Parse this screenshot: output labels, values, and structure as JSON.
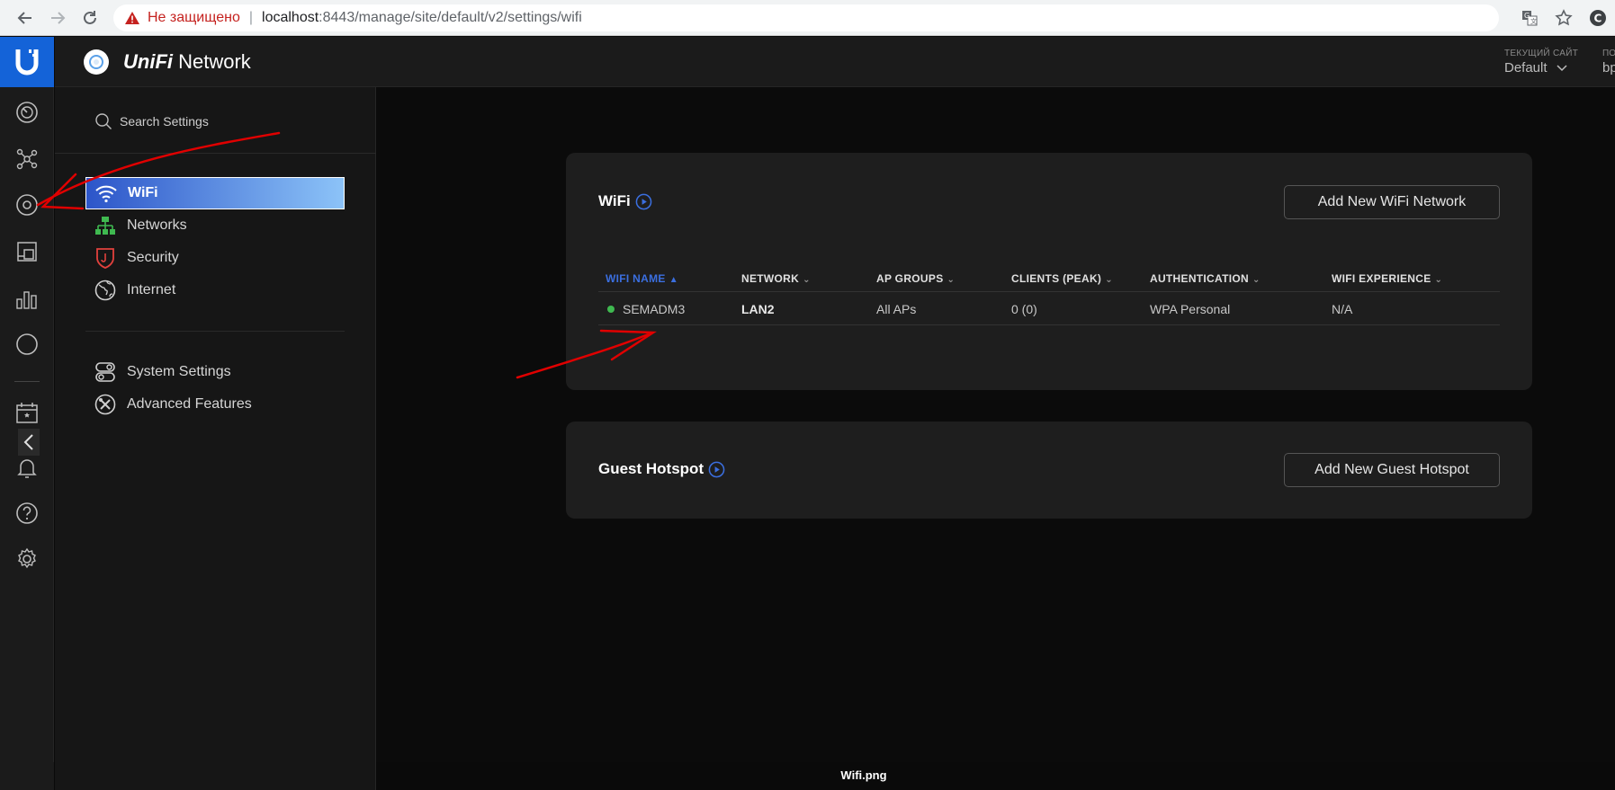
{
  "browser": {
    "insecure_label": "Не защищено",
    "url_host": "localhost",
    "url_path": ":8443/manage/site/default/v2/settings/wifi",
    "icons": [
      "back-icon",
      "forward-icon",
      "reload-icon",
      "warning-icon",
      "translate-icon",
      "star-icon",
      "profile-icon"
    ]
  },
  "header": {
    "brand_prefix": "UniFi",
    "brand_suffix": " Network",
    "site_label": "ТЕКУЩИЙ САЙТ",
    "site_value": "Default",
    "user_label": "ПО",
    "user_value": "bp"
  },
  "rail": {
    "icons": [
      "dashboard-icon",
      "topology-icon",
      "devices-icon",
      "clients-icon",
      "statistics-icon",
      "insights-icon",
      "events-icon",
      "alarms-icon",
      "help-icon",
      "settings-icon"
    ]
  },
  "settings_nav": {
    "search_placeholder": "Search Settings",
    "items": [
      {
        "label": "WiFi",
        "icon": "wifi-icon",
        "active": true
      },
      {
        "label": "Networks",
        "icon": "networks-icon",
        "active": false
      },
      {
        "label": "Security",
        "icon": "shield-icon",
        "active": false
      },
      {
        "label": "Internet",
        "icon": "globe-icon",
        "active": false
      }
    ],
    "items_2": [
      {
        "label": "System Settings",
        "icon": "toggles-icon"
      },
      {
        "label": "Advanced Features",
        "icon": "tools-icon"
      }
    ]
  },
  "wifi_card": {
    "title": "WiFi",
    "add_button": "Add New WiFi Network",
    "columns": [
      "WIFI NAME",
      "NETWORK",
      "AP GROUPS",
      "CLIENTS (PEAK)",
      "AUTHENTICATION",
      "WIFI EXPERIENCE"
    ],
    "sorted_column": "WIFI NAME",
    "rows": [
      {
        "name": "SEMADM3",
        "network": "LAN2",
        "ap_groups": "All APs",
        "clients": "0 (0)",
        "authentication": "WPA Personal",
        "experience": "N/A",
        "status_color": "#3fb950"
      }
    ]
  },
  "guest_card": {
    "title": "Guest Hotspot",
    "add_button": "Add New Guest Hotspot"
  },
  "footer": {
    "filename": "Wifi.png"
  },
  "colors": {
    "accent": "#1463d8",
    "sort_blue": "#3b6fe0",
    "annotation_red": "#e00000",
    "status_green": "#3fb950"
  }
}
